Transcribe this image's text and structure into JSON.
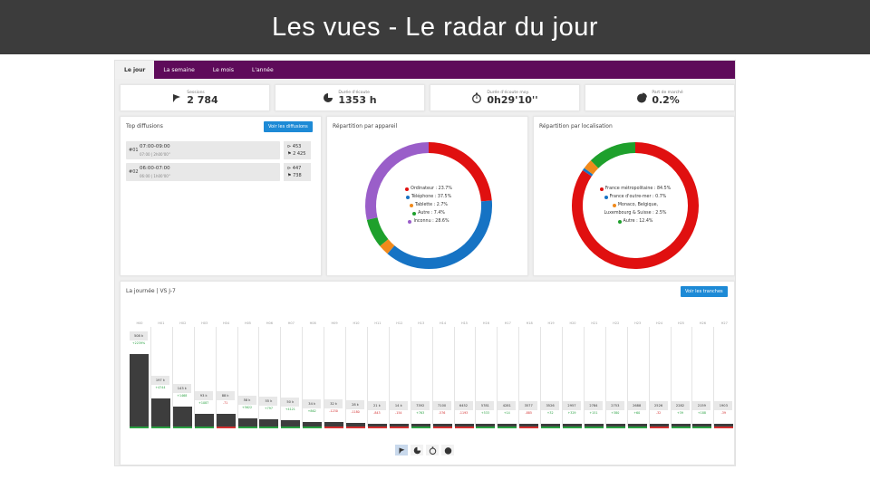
{
  "banner": {
    "title": "Les vues - Le radar du jour"
  },
  "tabs": [
    {
      "label": "Le jour",
      "active": true
    },
    {
      "label": "La semaine",
      "active": false
    },
    {
      "label": "Le mois",
      "active": false
    },
    {
      "label": "L'année",
      "active": false
    }
  ],
  "stats": [
    {
      "label": "Sessions",
      "value": "2 784",
      "icon": "share-icon"
    },
    {
      "label": "Durée d'écoute",
      "value": "1353 h",
      "icon": "pie-icon"
    },
    {
      "label": "Durée d'écoute moy.",
      "value": "0h29'10''",
      "icon": "stopwatch-icon"
    },
    {
      "label": "Part de marché",
      "value": "0.2%",
      "icon": "market-pie-icon"
    }
  ],
  "top_diffusions": {
    "title": "Top diffusions",
    "button": "Voir les diffusions",
    "rows": [
      {
        "rank": "#01",
        "time": "07:00-09:00",
        "sub": "07:00 | 2h00'00''",
        "views": "453",
        "shares": "2 425"
      },
      {
        "rank": "#02",
        "time": "06:00-07:00",
        "sub": "06:00 | 1h00'00''",
        "views": "447",
        "shares": "738"
      }
    ]
  },
  "device": {
    "title": "Répartition par appareil",
    "legend": [
      {
        "label": "Ordinateur : 23.7%",
        "color": "#e01010",
        "value": 23.7
      },
      {
        "label": "Téléphone : 37.5%",
        "color": "#1673c4",
        "value": 37.5
      },
      {
        "label": "Tablette : 2.7%",
        "color": "#f08a1c",
        "value": 2.7
      },
      {
        "label": "Autre : 7.4%",
        "color": "#1ea02c",
        "value": 7.4
      },
      {
        "label": "Inconnu : 28.6%",
        "color": "#9a5ec9",
        "value": 28.6
      }
    ]
  },
  "location": {
    "title": "Répartition par localisation",
    "legend": [
      {
        "label": "France métropolitaine : 84.5%",
        "color": "#e01010",
        "value": 84.5
      },
      {
        "label": "France d'outre-mer : 0.7%",
        "color": "#1673c4",
        "value": 0.7
      },
      {
        "label": "Monaco, Belgique,",
        "color": "#f08a1c",
        "value": 2.5
      },
      {
        "label": "Luxembourg & Suisse : 2.5%",
        "color": "",
        "value": null
      },
      {
        "label": "Autre : 12.4%",
        "color": "#1ea02c",
        "value": 12.4
      }
    ]
  },
  "timeline": {
    "title": "La journée | VS J-7",
    "button": "Voir les tranches",
    "columns": [
      {
        "label": "H00",
        "value": "508 k",
        "delta": "+2239%",
        "level": 1.0,
        "up": true
      },
      {
        "label": "H01",
        "value": "197 k",
        "delta": "+4744",
        "level": 0.39,
        "up": true
      },
      {
        "label": "H02",
        "value": "143 k",
        "delta": "+1468",
        "level": 0.28,
        "up": true
      },
      {
        "label": "H03",
        "value": "93 k",
        "delta": "+1087",
        "level": 0.18,
        "up": true
      },
      {
        "label": "H04",
        "value": "88 k",
        "delta": "-71",
        "level": 0.17,
        "up": false
      },
      {
        "label": "H05",
        "value": "58 k",
        "delta": "+5622",
        "level": 0.11,
        "up": true
      },
      {
        "label": "H06",
        "value": "55 k",
        "delta": "+797",
        "level": 0.1,
        "up": true
      },
      {
        "label": "H07",
        "value": "50 k",
        "delta": "+4121",
        "level": 0.09,
        "up": true
      },
      {
        "label": "H08",
        "value": "34 k",
        "delta": "+862",
        "level": 0.06,
        "up": true
      },
      {
        "label": "H09",
        "value": "32 k",
        "delta": "-1230",
        "level": 0.06,
        "up": false
      },
      {
        "label": "H10",
        "value": "28 k",
        "delta": "-1180",
        "level": 0.05,
        "up": false
      },
      {
        "label": "H11",
        "value": "21 k",
        "delta": "-843",
        "level": 0.04,
        "up": false
      },
      {
        "label": "H12",
        "value": "14 k",
        "delta": "-154",
        "level": 0.03,
        "up": false
      },
      {
        "label": "H13",
        "value": "7392",
        "delta": "+763",
        "level": 0.015,
        "up": true
      },
      {
        "label": "H14",
        "value": "7100",
        "delta": "-576",
        "level": 0.014,
        "up": false
      },
      {
        "label": "H15",
        "value": "6452",
        "delta": "-1193",
        "level": 0.013,
        "up": false
      },
      {
        "label": "H16",
        "value": "5781",
        "delta": "+533",
        "level": 0.011,
        "up": true
      },
      {
        "label": "H17",
        "value": "4281",
        "delta": "+14",
        "level": 0.008,
        "up": true
      },
      {
        "label": "H18",
        "value": "3577",
        "delta": "-885",
        "level": 0.007,
        "up": false
      },
      {
        "label": "H19",
        "value": "3526",
        "delta": "+32",
        "level": 0.007,
        "up": true
      },
      {
        "label": "H20",
        "value": "2957",
        "delta": "+329",
        "level": 0.006,
        "up": true
      },
      {
        "label": "H21",
        "value": "2784",
        "delta": "+151",
        "level": 0.005,
        "up": true
      },
      {
        "label": "H22",
        "value": "2753",
        "delta": "+380",
        "level": 0.005,
        "up": true
      },
      {
        "label": "H23",
        "value": "2688",
        "delta": "+60",
        "level": 0.005,
        "up": true
      },
      {
        "label": "H24",
        "value": "2526",
        "delta": "-32",
        "level": 0.005,
        "up": false
      },
      {
        "label": "H25",
        "value": "2282",
        "delta": "+39",
        "level": 0.004,
        "up": true
      },
      {
        "label": "H26",
        "value": "2159",
        "delta": "+188",
        "level": 0.004,
        "up": true
      },
      {
        "label": "H27",
        "value": "1903",
        "delta": "-39",
        "level": 0.004,
        "up": false
      }
    ]
  },
  "bottom_icons": [
    "share-icon",
    "pie-icon",
    "stopwatch-icon",
    "market-pie-icon"
  ],
  "colors": {
    "accent": "#5e0b5a",
    "button": "#1d8ad6",
    "bar": "#3d3d3d",
    "up": "#2aa142",
    "down": "#d33030"
  }
}
